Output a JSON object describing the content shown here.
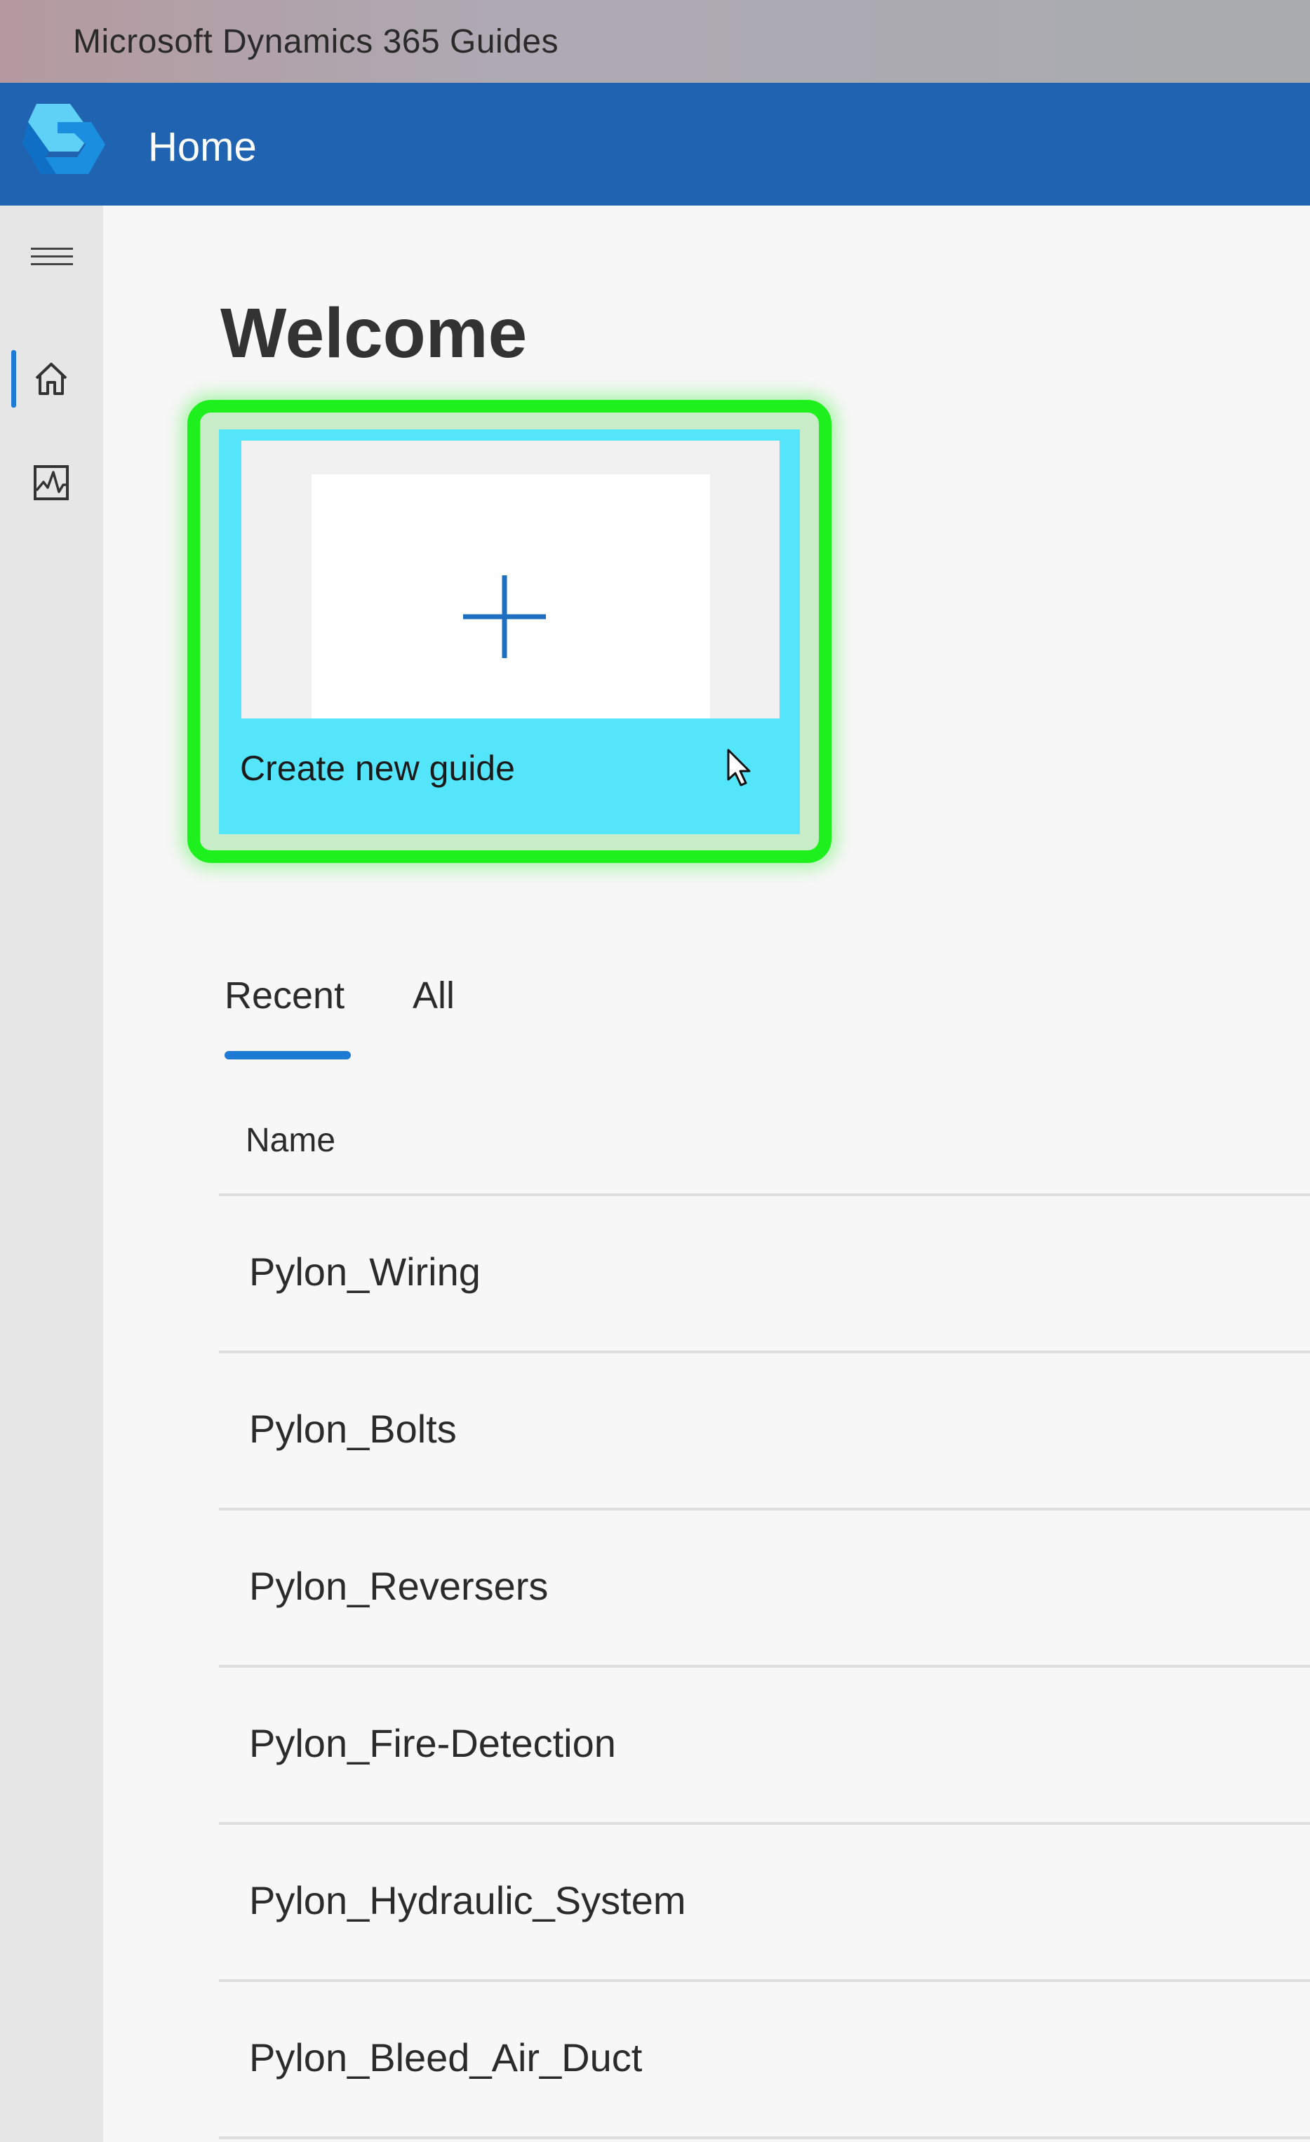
{
  "window": {
    "title": "Microsoft Dynamics 365 Guides"
  },
  "appbar": {
    "title": "Home",
    "logo_icon": "dynamics-365-guides-logo"
  },
  "sidebar": {
    "items": [
      {
        "icon": "hamburger-menu-icon"
      },
      {
        "icon": "home-icon",
        "active": true
      },
      {
        "icon": "analytics-icon"
      }
    ]
  },
  "main": {
    "heading": "Welcome",
    "create_card": {
      "label": "Create new guide",
      "icon": "plus-icon"
    },
    "tabs": [
      {
        "label": "Recent",
        "active": true
      },
      {
        "label": "All",
        "active": false
      }
    ],
    "table": {
      "column_header": "Name",
      "rows": [
        "Pylon_Wiring",
        "Pylon_Bolts",
        "Pylon_Reversers",
        "Pylon_Fire-Detection",
        "Pylon_Hydraulic_System",
        "Pylon_Bleed_Air_Duct"
      ]
    }
  },
  "colors": {
    "appbar": "#1f63b1",
    "accent": "#1f7ad6",
    "card_highlight": "#54e5fb",
    "focus_ring": "#1ef01e"
  }
}
